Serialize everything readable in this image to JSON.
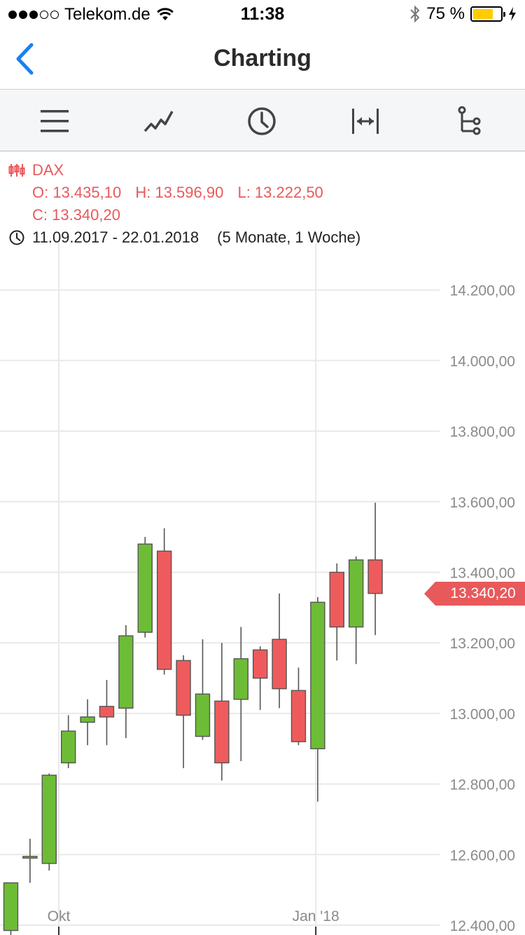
{
  "status_bar": {
    "carrier": "Telekom.de",
    "time": "11:38",
    "battery_percent": "75 %",
    "battery_level": 0.75,
    "signal_bars": 3,
    "signal_total": 5
  },
  "nav": {
    "title": "Charting",
    "back_icon": "chevron-left-icon"
  },
  "toolbar": {
    "items": [
      {
        "name": "menu-icon"
      },
      {
        "name": "line-chart-icon"
      },
      {
        "name": "clock-icon"
      },
      {
        "name": "range-icon"
      },
      {
        "name": "compare-icon"
      }
    ]
  },
  "instrument": {
    "name": "DAX",
    "open_label": "O: 13.435,10",
    "high_label": "H: 13.596,90",
    "low_label": "L: 13.222,50",
    "close_label": "C: 13.340,20",
    "date_range": "11.09.2017 - 22.01.2018",
    "duration": "(5 Monate, 1 Woche)",
    "last_price": "13.340,20"
  },
  "colors": {
    "up": "#6dbc36",
    "down": "#ef5b5c",
    "accent": "#e8595b",
    "ios_blue": "#1a80f2"
  },
  "chart_data": {
    "type": "candlestick",
    "title": "DAX",
    "ylim": [
      12400,
      14400
    ],
    "y_ticks": [
      "14.200,00",
      "14.000,00",
      "13.800,00",
      "13.600,00",
      "13.400,00",
      "13.200,00",
      "13.000,00",
      "12.800,00",
      "12.600,00",
      "12.400,00"
    ],
    "y_tick_values": [
      14200,
      14000,
      13800,
      13600,
      13400,
      13200,
      13000,
      12800,
      12600,
      12400
    ],
    "x_labels": [
      {
        "label": "Okt",
        "index": 2.5
      },
      {
        "label": "Jan '18",
        "index": 15.9
      }
    ],
    "x_offset": -0.3,
    "candles": [
      {
        "o": 12385,
        "h": 12480,
        "l": 12320,
        "c": 12520
      },
      {
        "o": 12590,
        "h": 12645,
        "l": 12520,
        "c": 12595
      },
      {
        "o": 12575,
        "h": 12830,
        "l": 12555,
        "c": 12825
      },
      {
        "o": 12860,
        "h": 12995,
        "l": 12845,
        "c": 12950
      },
      {
        "o": 12975,
        "h": 13040,
        "l": 12910,
        "c": 12990
      },
      {
        "o": 13020,
        "h": 13095,
        "l": 12910,
        "c": 12990
      },
      {
        "o": 13015,
        "h": 13250,
        "l": 12930,
        "c": 13220
      },
      {
        "o": 13230,
        "h": 13500,
        "l": 13215,
        "c": 13480
      },
      {
        "o": 13460,
        "h": 13525,
        "l": 13110,
        "c": 13125
      },
      {
        "o": 13150,
        "h": 13165,
        "l": 12845,
        "c": 12995
      },
      {
        "o": 12935,
        "h": 13210,
        "l": 12925,
        "c": 13055
      },
      {
        "o": 13035,
        "h": 13200,
        "l": 12810,
        "c": 12860
      },
      {
        "o": 13040,
        "h": 13245,
        "l": 12865,
        "c": 13155
      },
      {
        "o": 13180,
        "h": 13190,
        "l": 13010,
        "c": 13100
      },
      {
        "o": 13210,
        "h": 13340,
        "l": 13015,
        "c": 13070
      },
      {
        "o": 13065,
        "h": 13130,
        "l": 12910,
        "c": 12920
      },
      {
        "o": 12900,
        "h": 13330,
        "l": 12750,
        "c": 13315
      },
      {
        "o": 13400,
        "h": 13425,
        "l": 13150,
        "c": 13245
      },
      {
        "o": 13245,
        "h": 13445,
        "l": 13140,
        "c": 13435
      },
      {
        "o": 13435,
        "h": 13597,
        "l": 13222,
        "c": 13340
      }
    ]
  }
}
